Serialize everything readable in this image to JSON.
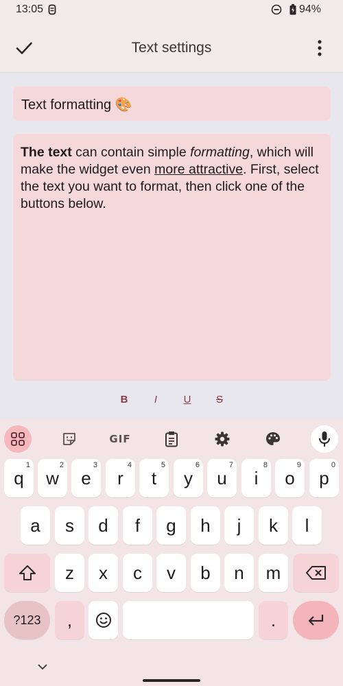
{
  "status_bar": {
    "time": "13:05",
    "battery": "94%",
    "icons": [
      "notification-icon",
      "dnd-icon",
      "battery-icon"
    ]
  },
  "app_bar": {
    "title": "Text settings",
    "icons": [
      "check-icon",
      "more-vert-icon"
    ]
  },
  "title_field": {
    "value": "Text formatting 🎨"
  },
  "body_field": {
    "segments": [
      {
        "text": "The text",
        "style": "bold"
      },
      {
        "text": " can contain simple ",
        "style": "normal"
      },
      {
        "text": "formatting",
        "style": "italic"
      },
      {
        "text": ", which will make the widget even ",
        "style": "normal"
      },
      {
        "text": "more attractive",
        "style": "underline"
      },
      {
        "text": ". First, select the text you want to format, then click one of the buttons below.",
        "style": "normal"
      }
    ]
  },
  "format_bar": {
    "bold": "B",
    "italic": "I",
    "underline": "U",
    "strike": "S"
  },
  "keyboard": {
    "toolbar": {
      "gif_label": "GIF",
      "icons": [
        "apps-grid-icon",
        "sticker-icon",
        "clipboard-icon",
        "settings-icon",
        "palette-icon",
        "mic-icon"
      ]
    },
    "row1": [
      {
        "key": "q",
        "num": "1"
      },
      {
        "key": "w",
        "num": "2"
      },
      {
        "key": "e",
        "num": "3"
      },
      {
        "key": "r",
        "num": "4"
      },
      {
        "key": "t",
        "num": "5"
      },
      {
        "key": "y",
        "num": "6"
      },
      {
        "key": "u",
        "num": "7"
      },
      {
        "key": "i",
        "num": "8"
      },
      {
        "key": "o",
        "num": "9"
      },
      {
        "key": "p",
        "num": "0"
      }
    ],
    "row2": [
      "a",
      "s",
      "d",
      "f",
      "g",
      "h",
      "j",
      "k",
      "l"
    ],
    "row3": [
      "z",
      "x",
      "c",
      "v",
      "b",
      "n",
      "m"
    ],
    "row4": {
      "symbols": "?123",
      "comma": ",",
      "period": "."
    },
    "colors": {
      "background": "#f3e5e7",
      "accent": "#f4b8bd",
      "key": "#ffffff"
    }
  }
}
